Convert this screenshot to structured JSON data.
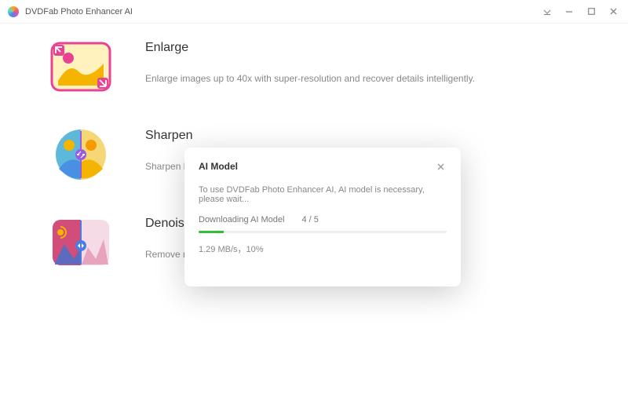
{
  "titlebar": {
    "app_name": "DVDFab Photo Enhancer AI"
  },
  "features": {
    "enlarge": {
      "title": "Enlarge",
      "desc": "Enlarge images up to 40x with super-resolution and recover details intelligently."
    },
    "sharpen": {
      "title": "Sharpen",
      "desc": "Sharpen blu"
    },
    "denoise": {
      "title": "Denoise",
      "desc": "Remove noises from images while preserve details for clear effects."
    }
  },
  "modal": {
    "title": "AI Model",
    "message": "To use DVDFab Photo Enhancer AI, AI model is necessary, please wait...",
    "download_label": "Downloading AI Model",
    "download_count": "4 / 5",
    "progress_percent": 10,
    "speed_text": "1.29 MB/s，10%"
  }
}
